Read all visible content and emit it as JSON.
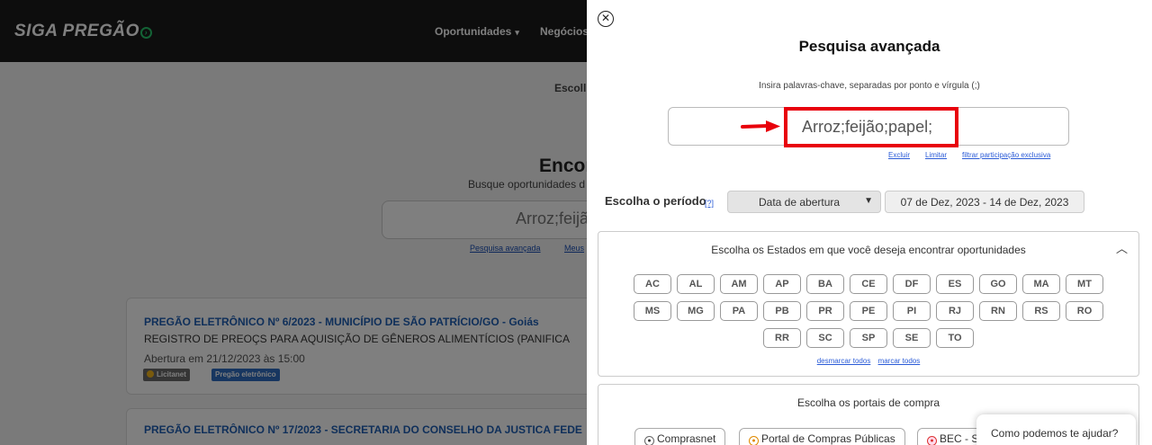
{
  "header": {
    "logo": "SIGA PREGÃO",
    "nav": {
      "opportunities": "Oportunidades",
      "business": "Negócios"
    }
  },
  "background": {
    "choose_text": "Escoll",
    "find_title": "Encor",
    "find_subtitle": "Busque oportunidades d",
    "search_value": "Arroz;feijã",
    "link_advanced": "Pesquisa avançada",
    "link_my": "Meus",
    "cards": [
      {
        "title": "PREGÃO ELETRÔNICO Nº 6/2023 - MUNICÍPIO DE SÃO PATRÍCIO/GO - Goiás",
        "description": "REGISTRO DE PREOÇS PARA AQUISIÇÃO DE GÊNEROS ALIMENTÍCIOS (PANIFICA",
        "opening": "Abertura em 21/12/2023 às 15:00",
        "tags": [
          "Licitanet",
          "Pregão eletrônico"
        ]
      },
      {
        "title": "PREGÃO ELETRÔNICO Nº 17/2023 - SECRETARIA DO CONSELHO DA JUSTICA FEDE"
      }
    ]
  },
  "modal": {
    "close_icon": "close-icon",
    "title": "Pesquisa avançada",
    "hint": "Insira palavras-chave, separadas por ponto e vírgula (;)",
    "keyword_value": "Arroz;feijão;papel;",
    "keyword_links": {
      "delete": "Excluir",
      "limit": "Limitar",
      "filter": "filtrar participação exclusiva"
    },
    "period": {
      "label": "Escolha o período",
      "help": "[?]",
      "select_value": "Data de abertura",
      "date_range": "07 de Dez, 2023 - 14 de Dez, 2023"
    },
    "states": {
      "title": "Escolha os Estados em que você deseja encontrar oportunidades",
      "rows": [
        [
          "AC",
          "AL",
          "AM",
          "AP",
          "BA",
          "CE",
          "DF",
          "ES",
          "GO",
          "MA",
          "MT"
        ],
        [
          "MS",
          "MG",
          "PA",
          "PB",
          "PR",
          "PE",
          "PI",
          "RJ",
          "RN",
          "RS",
          "RO"
        ],
        [
          "RR",
          "SC",
          "SP",
          "SE",
          "TO"
        ]
      ],
      "unmark_all": "desmarcar todos",
      "mark_all": "marcar todos"
    },
    "portals": {
      "title": "Escolha os portais de compra",
      "items": [
        "Comprasnet",
        "Portal de Compras Públicas",
        "BEC - S"
      ]
    }
  },
  "chat": {
    "label": "Como podemos te ajudar?"
  },
  "colors": {
    "highlight": "#e8000b",
    "link": "#2a5bd7",
    "card_title": "#1f5fb4"
  }
}
